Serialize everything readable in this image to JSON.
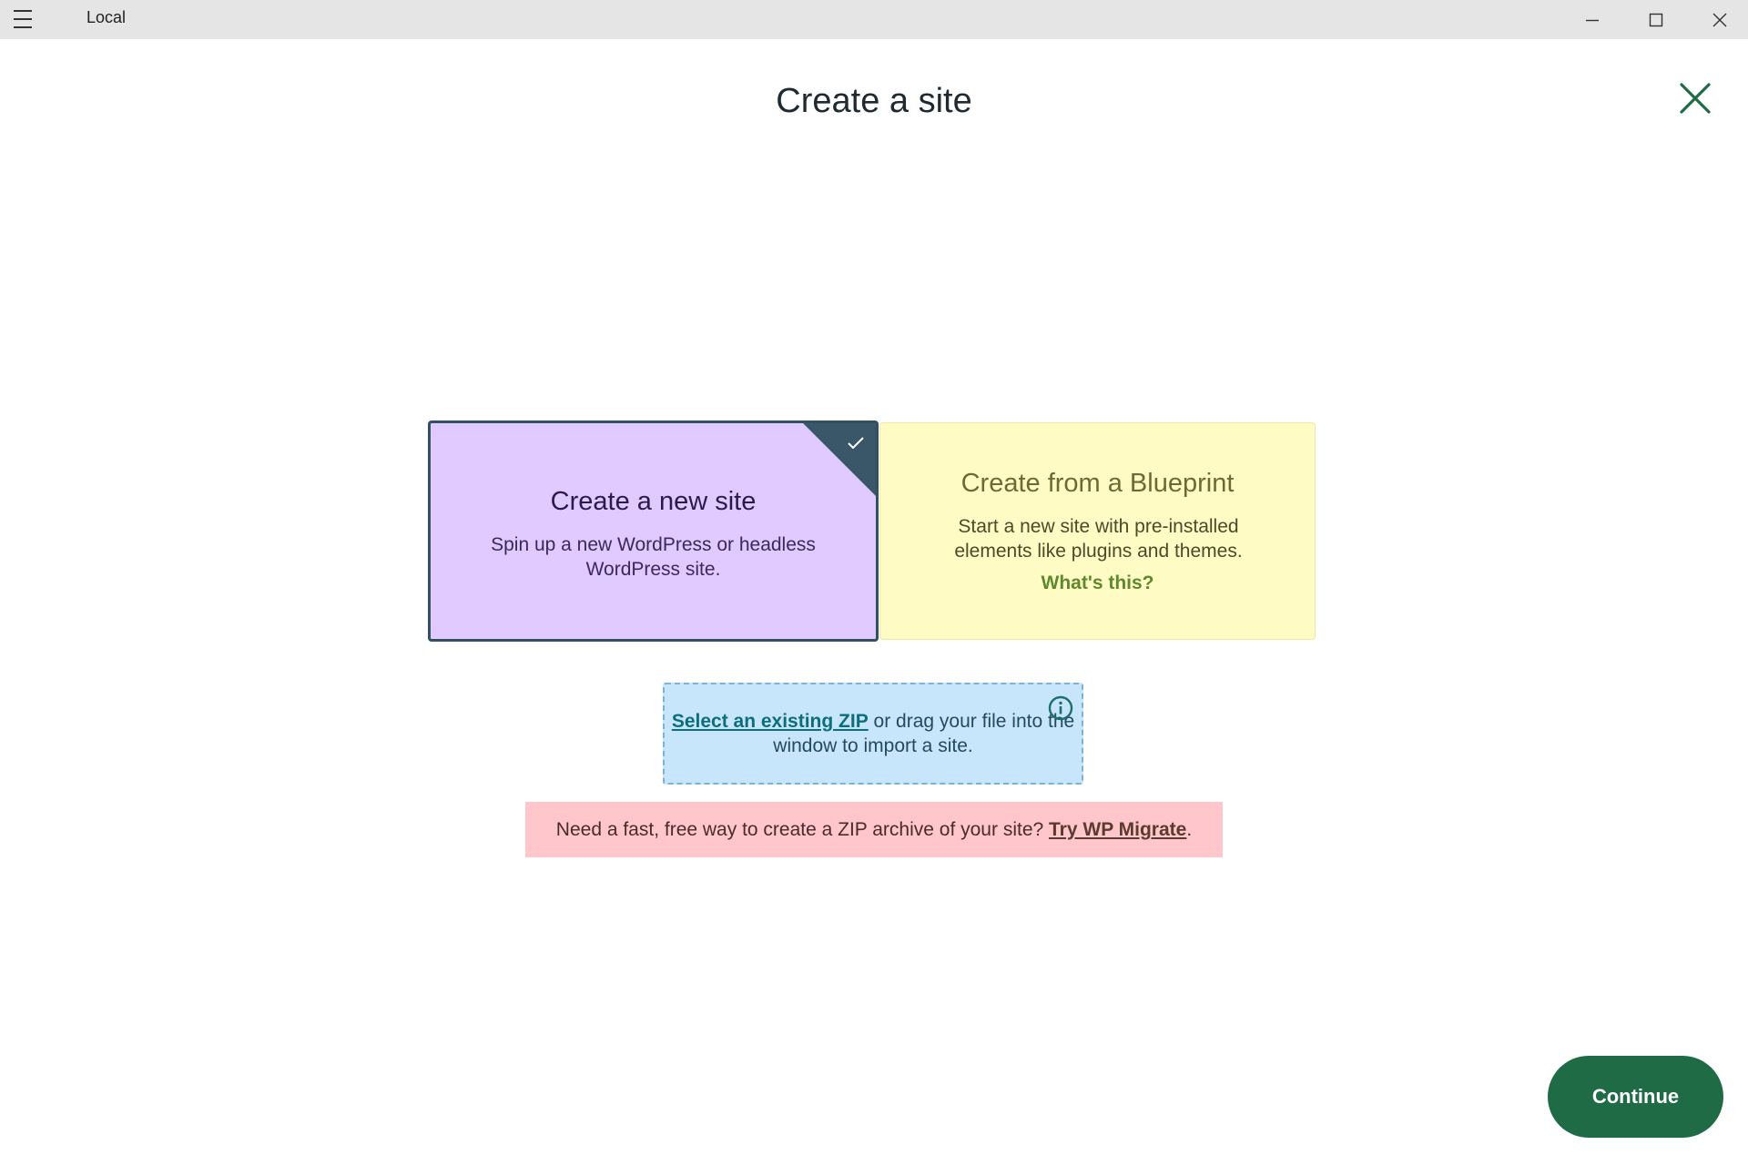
{
  "window": {
    "title": "Local",
    "menu_icon": "hamburger-menu-icon",
    "controls": [
      "minimize-icon",
      "maximize-icon",
      "close-icon"
    ]
  },
  "dialog": {
    "title": "Create a site",
    "close_icon": "close-icon"
  },
  "options": {
    "new_site": {
      "heading": "Create a new site",
      "description": "Spin up a new WordPress or headless WordPress site.",
      "selected": true,
      "check_icon": "checkmark-icon"
    },
    "blueprint": {
      "heading": "Create from a Blueprint",
      "description": "Start a new site with pre-installed elements like plugins and themes.",
      "link": "What's this?"
    }
  },
  "zip_import": {
    "link": "Select an existing ZIP",
    "text_after_link": " or drag your file into the window to import a site.",
    "info_icon": "info-icon"
  },
  "migrate_banner": {
    "text": "Need a fast, free way to create a ZIP archive of your site? ",
    "link": "Try WP Migrate",
    "suffix": "."
  },
  "footer": {
    "continue_label": "Continue"
  },
  "colors": {
    "accent": "#1f6b46",
    "new_site_card": "#e0caff",
    "blueprint_card": "#fffbc4",
    "zip_box": "#c8e6fb",
    "banner": "#ffc7cb"
  }
}
